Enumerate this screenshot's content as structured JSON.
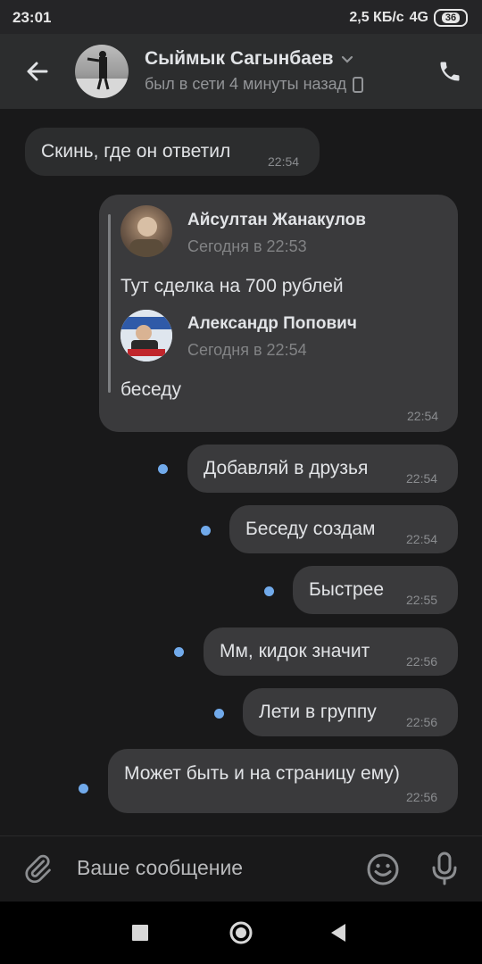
{
  "status_bar": {
    "time": "23:01",
    "network_speed": "2,5 КБ/с",
    "network_type": "4G",
    "battery": "36"
  },
  "header": {
    "contact_name": "Сыймык Сагынбаев",
    "last_seen": "был в сети 4 минуты назад"
  },
  "messages": [
    {
      "text": "Скинь, где он ответил",
      "time": "22:54",
      "direction": "in"
    },
    {
      "direction": "out",
      "time": "22:54",
      "forwarded": [
        {
          "author": "Айсултан Жанакулов",
          "date": "Сегодня в 22:53",
          "text": "Тут сделка на 700 рублей"
        },
        {
          "author": "Александр Попович",
          "date": "Сегодня в 22:54",
          "text": "беседу"
        }
      ]
    },
    {
      "text": "Добавляй в друзья",
      "time": "22:54",
      "direction": "out",
      "unread": true
    },
    {
      "text": "Беседу создам",
      "time": "22:54",
      "direction": "out",
      "unread": true
    },
    {
      "text": "Быстрее",
      "time": "22:55",
      "direction": "out",
      "unread": true
    },
    {
      "text": "Мм, кидок значит",
      "time": "22:56",
      "direction": "out",
      "unread": true
    },
    {
      "text": "Лети в группу",
      "time": "22:56",
      "direction": "out",
      "unread": true
    },
    {
      "text": "Может быть и на страницу ему)",
      "time": "22:56",
      "direction": "out",
      "unread": true
    }
  ],
  "composer": {
    "placeholder": "Ваше сообщение"
  },
  "colors": {
    "background": "#19191a",
    "bubble_in": "#2c2d2e",
    "bubble_out": "#3a3a3c",
    "unread_dot": "#71aaeb"
  },
  "icons": [
    "back-arrow-icon",
    "chevron-down-icon",
    "mobile-icon",
    "phone-icon",
    "attach-icon",
    "emoji-icon",
    "mic-icon",
    "nav-recents-icon",
    "nav-home-icon",
    "nav-back-icon"
  ]
}
